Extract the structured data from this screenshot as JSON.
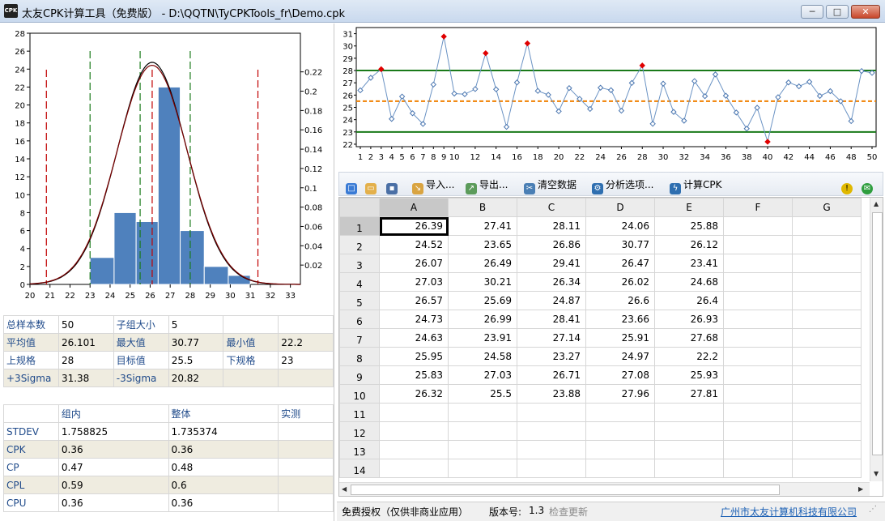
{
  "window": {
    "title": "太友CPK计算工具（免费版） - D:\\QQTN\\TyCPKTools_fr\\Demo.cpk",
    "app_icon_text": "CPK",
    "minimize_glyph": "─",
    "maximize_glyph": "□",
    "close_glyph": "✕"
  },
  "chart_data": [
    {
      "type": "bar",
      "x": [
        21,
        22,
        23,
        24,
        25,
        26,
        27,
        28,
        29,
        30,
        31,
        32,
        33
      ],
      "x_ticks": [
        20,
        21,
        22,
        23,
        24,
        25,
        26,
        27,
        28,
        29,
        30,
        31,
        32,
        33
      ],
      "bins": [
        {
          "from": 23.0,
          "to": 24.2,
          "count": 3
        },
        {
          "from": 24.2,
          "to": 25.3,
          "count": 8
        },
        {
          "from": 25.3,
          "to": 26.4,
          "count": 7
        },
        {
          "from": 26.4,
          "to": 27.5,
          "count": 22
        },
        {
          "from": 27.5,
          "to": 28.7,
          "count": 6
        },
        {
          "from": 28.7,
          "to": 29.9,
          "count": 2
        },
        {
          "from": 29.9,
          "to": 31.0,
          "count": 1
        }
      ],
      "y_ticks": [
        0,
        2,
        4,
        6,
        8,
        10,
        12,
        14,
        16,
        18,
        20,
        22,
        24,
        26,
        28
      ],
      "ylim": [
        0,
        28
      ],
      "xlim": [
        20,
        33.5
      ],
      "y2_ticks": [
        0.02,
        0.04,
        0.06,
        0.08,
        0.1,
        0.12,
        0.14,
        0.16,
        0.18,
        0.2,
        0.22
      ],
      "y2lim": [
        0,
        0.26
      ],
      "density_mean": 26.101,
      "density_sd_within": 1.758825,
      "density_sd_overall": 1.735374,
      "red_lines": [
        20.82,
        26.101,
        31.38
      ],
      "green_lines": [
        23,
        25.5,
        28
      ],
      "colors": {
        "bar": "#4f81bd",
        "curve_within": "#7a0000",
        "curve_overall": "#000000",
        "red": "#c00000",
        "green": "#1a7a1a"
      }
    },
    {
      "type": "line",
      "values": [
        26.39,
        27.41,
        28.11,
        24.06,
        25.88,
        24.52,
        23.65,
        26.86,
        30.77,
        26.12,
        26.07,
        26.49,
        29.41,
        26.47,
        23.41,
        27.03,
        30.21,
        26.34,
        26.02,
        24.68,
        26.57,
        25.69,
        24.87,
        26.6,
        26.4,
        24.73,
        26.99,
        28.41,
        23.66,
        26.93,
        24.63,
        23.91,
        27.14,
        25.91,
        27.68,
        25.95,
        24.58,
        23.27,
        24.97,
        22.2,
        25.83,
        27.03,
        26.71,
        27.08,
        25.93,
        26.32,
        25.5,
        23.88,
        27.96,
        27.81
      ],
      "x_ticks": [
        1,
        2,
        3,
        4,
        5,
        6,
        7,
        8,
        9,
        10,
        12,
        14,
        16,
        18,
        20,
        22,
        24,
        26,
        28,
        30,
        32,
        34,
        36,
        38,
        40,
        42,
        44,
        46,
        48,
        50
      ],
      "y_ticks": [
        22,
        23,
        24,
        25,
        26,
        27,
        28,
        29,
        30,
        31
      ],
      "ylim": [
        21.8,
        31.5
      ],
      "usl": 28,
      "lsl": 23,
      "target": 25.5,
      "colors": {
        "line": "#6b93c4",
        "point": "#4a76b0",
        "out": "#e00000",
        "limit": "#1a7a1a",
        "center": "#f08000"
      }
    }
  ],
  "stats_top": [
    [
      {
        "t": "总样本数",
        "l": true
      },
      {
        "t": "50"
      },
      {
        "t": "子组大小",
        "l": true
      },
      {
        "t": "5"
      },
      {
        "t": ""
      },
      {
        "t": ""
      }
    ],
    [
      {
        "t": "平均值",
        "l": true
      },
      {
        "t": "26.101"
      },
      {
        "t": "最大值",
        "l": true
      },
      {
        "t": "30.77"
      },
      {
        "t": "最小值",
        "l": true
      },
      {
        "t": "22.2"
      }
    ],
    [
      {
        "t": "上规格",
        "l": true
      },
      {
        "t": "28"
      },
      {
        "t": "目标值",
        "l": true
      },
      {
        "t": "25.5"
      },
      {
        "t": "下规格",
        "l": true
      },
      {
        "t": "23"
      }
    ],
    [
      {
        "t": "+3Sigma",
        "l": true
      },
      {
        "t": "31.38"
      },
      {
        "t": "-3Sigma",
        "l": true
      },
      {
        "t": "20.82"
      },
      {
        "t": ""
      },
      {
        "t": ""
      }
    ]
  ],
  "stats_bottom": {
    "headers": [
      "",
      "组内",
      "整体",
      "实测"
    ],
    "rows": [
      [
        "STDEV",
        "1.758825",
        "1.735374",
        ""
      ],
      [
        "CPK",
        "0.36",
        "0.36",
        ""
      ],
      [
        "CP",
        "0.47",
        "0.48",
        ""
      ],
      [
        "CPL",
        "0.59",
        "0.6",
        ""
      ],
      [
        "CPU",
        "0.36",
        "0.36",
        ""
      ]
    ]
  },
  "toolbar": {
    "import": "导入...",
    "export": "导出...",
    "clear": "清空数据",
    "options": "分析选项...",
    "calc": "计算CPK"
  },
  "grid": {
    "columns": [
      "A",
      "B",
      "C",
      "D",
      "E",
      "F",
      "G"
    ],
    "rows": [
      [
        "26.39",
        "27.41",
        "28.11",
        "24.06",
        "25.88"
      ],
      [
        "24.52",
        "23.65",
        "26.86",
        "30.77",
        "26.12"
      ],
      [
        "26.07",
        "26.49",
        "29.41",
        "26.47",
        "23.41"
      ],
      [
        "27.03",
        "30.21",
        "26.34",
        "26.02",
        "24.68"
      ],
      [
        "26.57",
        "25.69",
        "24.87",
        "26.6",
        "26.4"
      ],
      [
        "24.73",
        "26.99",
        "28.41",
        "23.66",
        "26.93"
      ],
      [
        "24.63",
        "23.91",
        "27.14",
        "25.91",
        "27.68"
      ],
      [
        "25.95",
        "24.58",
        "23.27",
        "24.97",
        "22.2"
      ],
      [
        "25.83",
        "27.03",
        "26.71",
        "27.08",
        "25.93"
      ],
      [
        "26.32",
        "25.5",
        "23.88",
        "27.96",
        "27.81"
      ]
    ],
    "row_numbers": [
      "1",
      "2",
      "3",
      "4",
      "5",
      "6",
      "7",
      "8",
      "9",
      "10",
      "11",
      "12",
      "13",
      "14"
    ]
  },
  "status": {
    "license": "免费授权（仅供非商业应用）",
    "version_label": "版本号:",
    "version": "1.3",
    "update": "检查更新",
    "company": "广州市太友计算机科技有限公司"
  }
}
